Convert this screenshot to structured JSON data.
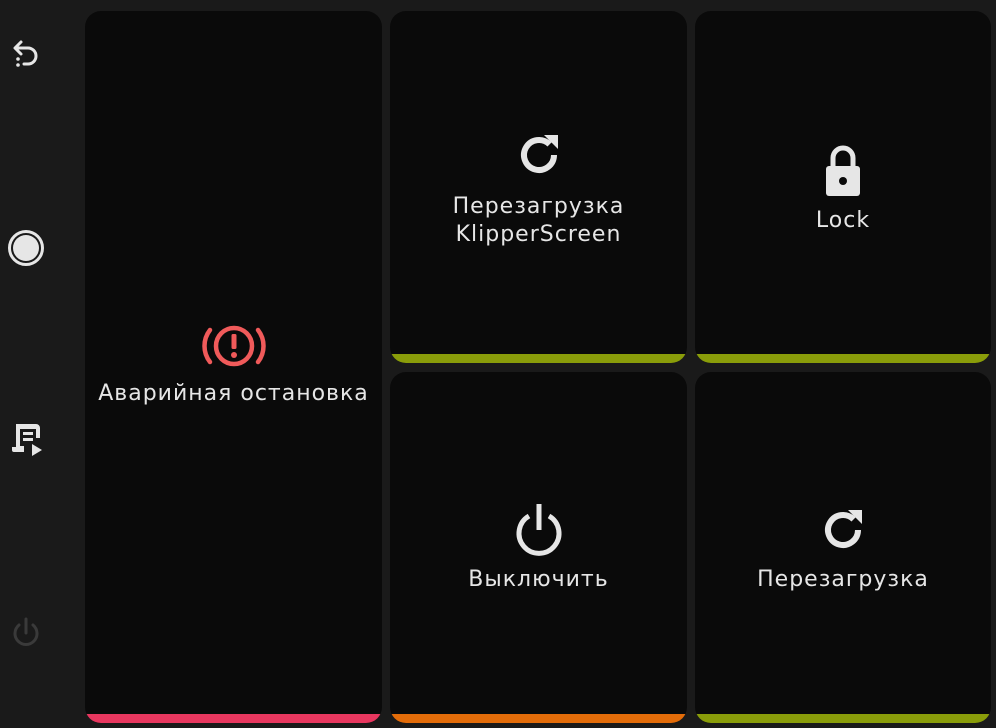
{
  "colors": {
    "background": "#1a1a1a",
    "tile": "#0a0a0a",
    "text": "#e6e6e6",
    "icon": "#e6e6e6",
    "emergency_icon": "#f05a5a",
    "bar_red": "#e8375f",
    "bar_green": "#8a9d0a",
    "bar_orange": "#e36c09",
    "disabled_icon": "#3a3a3a"
  },
  "sidebar": {
    "items": [
      {
        "name": "back",
        "icon": "back-arrow-icon"
      },
      {
        "name": "home",
        "icon": "circle-icon"
      },
      {
        "name": "macros",
        "icon": "script-run-icon"
      },
      {
        "name": "power",
        "icon": "power-icon",
        "disabled": true
      }
    ]
  },
  "tiles": {
    "emergency_stop": {
      "label": "Аварийная остановка",
      "icon": "emergency-icon",
      "bar": "red"
    },
    "restart_screen": {
      "label": "Перезагрузка\nKlipperScreen",
      "icon": "refresh-icon",
      "bar": "green"
    },
    "lock": {
      "label": "Lock",
      "icon": "lock-icon",
      "bar": "green"
    },
    "shutdown": {
      "label": "Выключить",
      "icon": "power-icon",
      "bar": "orange"
    },
    "restart": {
      "label": "Перезагрузка",
      "icon": "refresh-icon",
      "bar": "green"
    }
  }
}
